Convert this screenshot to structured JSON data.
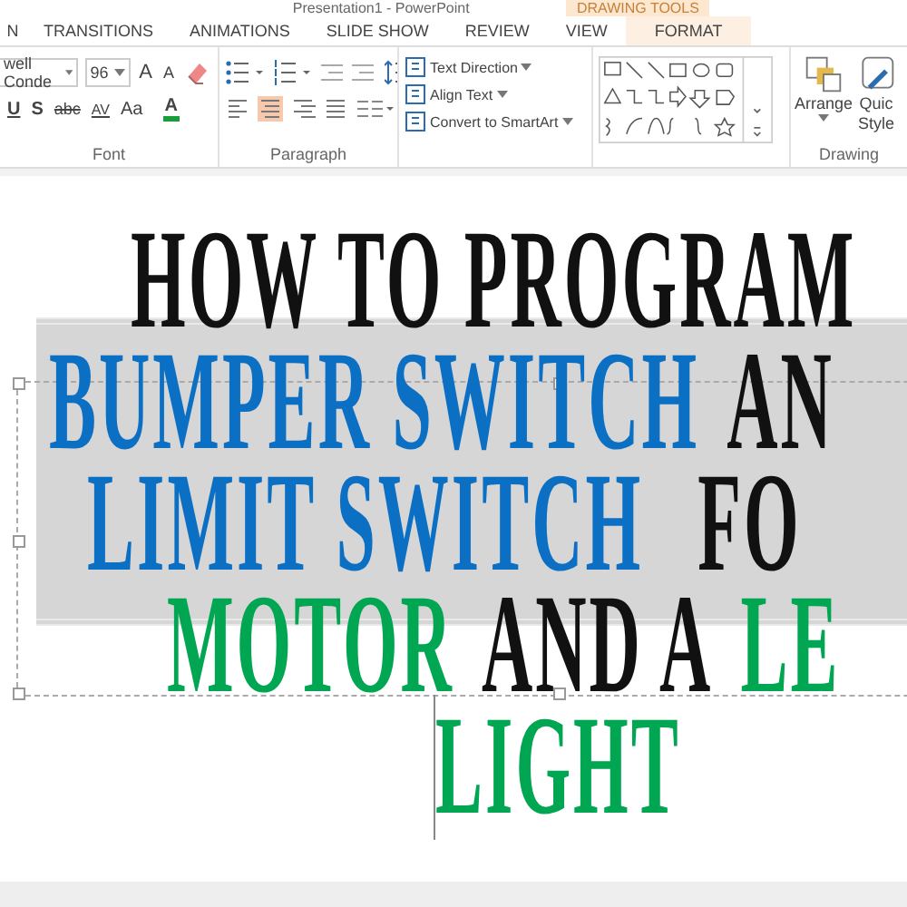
{
  "window": {
    "title": "Presentation1 - PowerPoint",
    "context_label": "DRAWING TOOLS"
  },
  "tabs": [
    {
      "label": "N",
      "selected": false
    },
    {
      "label": "TRANSITIONS",
      "selected": false
    },
    {
      "label": "ANIMATIONS",
      "selected": false
    },
    {
      "label": "SLIDE SHOW",
      "selected": false
    },
    {
      "label": "REVIEW",
      "selected": false
    },
    {
      "label": "VIEW",
      "selected": false
    },
    {
      "label": "FORMAT",
      "selected": true
    }
  ],
  "font_group": {
    "font_name": "well Conde",
    "font_size": "96",
    "grow": "A",
    "shrink": "A",
    "underline": "U",
    "shadow": "S",
    "strikethrough": "abc",
    "spacing": "AV",
    "change_case": "Aa",
    "font_color": "A",
    "label": "Font"
  },
  "paragraph_group": {
    "alignments": [
      {
        "kind": "left",
        "selected": false
      },
      {
        "kind": "center",
        "selected": true
      },
      {
        "kind": "right",
        "selected": false
      },
      {
        "kind": "justify",
        "selected": false
      }
    ],
    "commands": [
      "Text Direction",
      "Align Text",
      "Convert to SmartArt"
    ],
    "label": "Paragraph"
  },
  "drawing_group": {
    "arrange": "Arrange",
    "quick_styles": [
      "Quic",
      "Style"
    ],
    "label": "Drawing"
  },
  "slide": {
    "lines": [
      {
        "segments": [
          {
            "text": "HOW TO PROGRAM",
            "color": "#111111"
          }
        ]
      },
      {
        "segments": [
          {
            "text": "BUMPER SWITCH",
            "color": "#0b6fc4"
          },
          {
            "text": "AN",
            "color": "#111111"
          }
        ]
      },
      {
        "segments": [
          {
            "text": "LIMIT SWITCH",
            "color": "#0b6fc4"
          },
          {
            "text": "FO",
            "color": "#111111"
          }
        ]
      },
      {
        "segments": [
          {
            "text": "MOTOR",
            "color": "#00a651"
          },
          {
            "text": "AND A",
            "color": "#111111"
          },
          {
            "text": "LE",
            "color": "#00a651"
          }
        ]
      },
      {
        "segments": [
          {
            "text": "LIGHT",
            "color": "#00a651"
          }
        ]
      }
    ]
  }
}
